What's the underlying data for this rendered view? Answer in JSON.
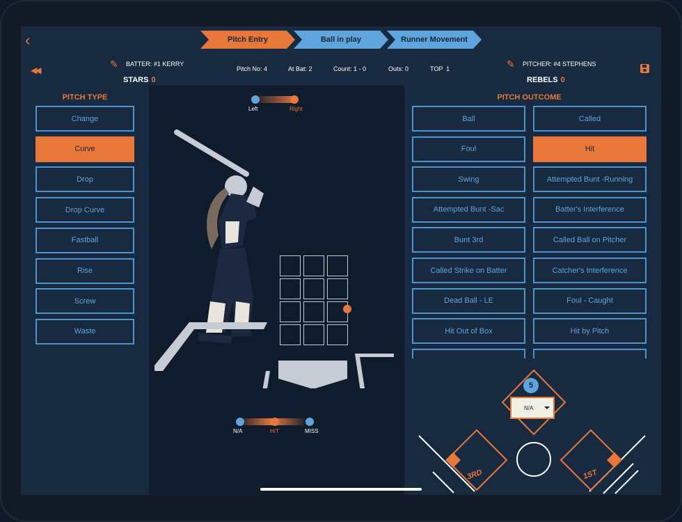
{
  "nav": {
    "back_icon": "chevron-left-icon",
    "steps": [
      {
        "label": "Pitch Entry",
        "active": true
      },
      {
        "label": "Ball in play",
        "active": false
      },
      {
        "label": "Runner Movement",
        "active": false
      }
    ]
  },
  "header": {
    "rewind_icon": "rewind-icon",
    "batter_label": "BATTER: #1 KERRY",
    "pitcher_label": "PITCHER: #4 STEPHENS",
    "home_team": {
      "name": "STARS",
      "score": "0"
    },
    "away_team": {
      "name": "REBELS",
      "score": "0"
    },
    "pitch_no": "Pitch No: 4",
    "at_bat": "At Bat: 2",
    "count": "Count: 1 - 0",
    "outs": "Outs: 0",
    "inning": "TOP  1",
    "save_icon": "save-icon",
    "edit_icon": "pencil-icon"
  },
  "pitch_type": {
    "title": "PITCH TYPE",
    "items": [
      {
        "label": "Change",
        "selected": false
      },
      {
        "label": "Curve",
        "selected": true
      },
      {
        "label": "Drop",
        "selected": false
      },
      {
        "label": "Drop Curve",
        "selected": false
      },
      {
        "label": "Fastball",
        "selected": false
      },
      {
        "label": "Rise",
        "selected": false
      },
      {
        "label": "Screw",
        "selected": false
      },
      {
        "label": "Waste",
        "selected": false
      }
    ]
  },
  "field": {
    "batter_side": {
      "options": [
        "Left",
        "Right"
      ],
      "selected": "Right"
    },
    "contact": {
      "options": [
        "N/A",
        "HIT",
        "MISS"
      ],
      "selected": "HIT"
    },
    "strike_zone": {
      "rows": 4,
      "cols": 3
    }
  },
  "pitch_outcome": {
    "title": "PITCH OUTCOME",
    "items": [
      {
        "label": "Ball",
        "selected": false
      },
      {
        "label": "Called",
        "selected": false
      },
      {
        "label": "Foul",
        "selected": false
      },
      {
        "label": "Hit",
        "selected": true
      },
      {
        "label": "Swing",
        "selected": false
      },
      {
        "label": "Attempted Bunt -Running",
        "selected": false
      },
      {
        "label": "Attempted Bunt -Sac",
        "selected": false
      },
      {
        "label": "Batter's Interference",
        "selected": false
      },
      {
        "label": "Bunt 3rd",
        "selected": false
      },
      {
        "label": "Called Ball on Pitcher",
        "selected": false
      },
      {
        "label": "Called Strike on Batter",
        "selected": false
      },
      {
        "label": "Catcher's Interference",
        "selected": false
      },
      {
        "label": "Dead Ball - LE",
        "selected": false
      },
      {
        "label": "Foul - Caught",
        "selected": false
      },
      {
        "label": "Hit Out of Box",
        "selected": false
      },
      {
        "label": "Hit by Pitch",
        "selected": false
      }
    ]
  },
  "diamond": {
    "pitcher_number": "5",
    "pitcher_select": "N/A",
    "third_base": "3RD",
    "first_base": "1ST"
  }
}
